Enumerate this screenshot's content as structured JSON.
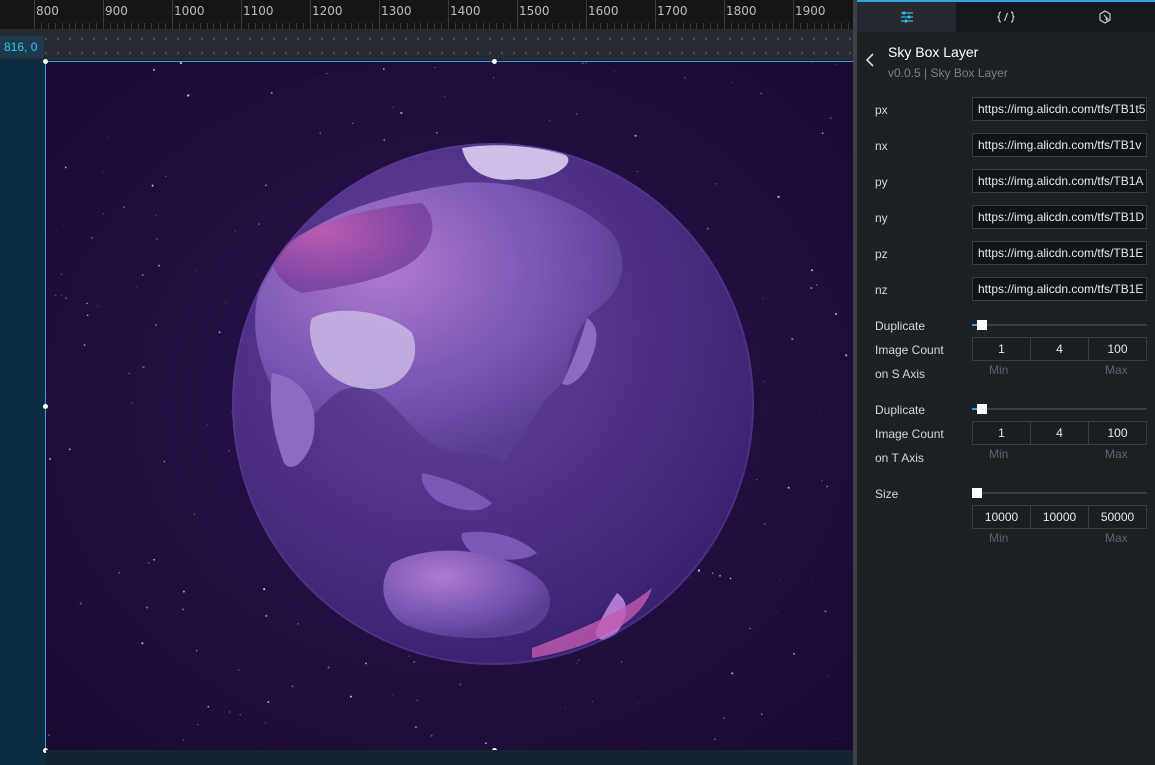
{
  "ruler": {
    "ticks": [
      "800",
      "900",
      "1000",
      "1100",
      "1200",
      "1300",
      "1400",
      "1500",
      "1600",
      "1700",
      "1800",
      "1900"
    ]
  },
  "canvas": {
    "coordinate_readout": "816, 0"
  },
  "panel": {
    "tabs": [
      {
        "name": "settings",
        "icon": "sliders-icon",
        "active": true
      },
      {
        "name": "code",
        "icon": "code-braces-icon",
        "active": false
      },
      {
        "name": "interaction",
        "icon": "interaction-icon",
        "active": false
      }
    ],
    "title": "Sky Box Layer",
    "subtitle": "v0.0.5 | Sky Box Layer",
    "images": [
      {
        "label": "px",
        "value": "https://img.alicdn.com/tfs/TB1t5"
      },
      {
        "label": "nx",
        "value": "https://img.alicdn.com/tfs/TB1v"
      },
      {
        "label": "py",
        "value": "https://img.alicdn.com/tfs/TB1A"
      },
      {
        "label": "ny",
        "value": "https://img.alicdn.com/tfs/TB1D"
      },
      {
        "label": "pz",
        "value": "https://img.alicdn.com/tfs/TB1E"
      },
      {
        "label": "nz",
        "value": "https://img.alicdn.com/tfs/TB1E"
      }
    ],
    "dup_s": {
      "label_lines": [
        "Duplicate",
        "Image Count",
        "on S Axis"
      ],
      "min": "1",
      "value": "4",
      "max": "100",
      "min_label": "Min",
      "max_label": "Max",
      "level": 0.03
    },
    "dup_t": {
      "label_lines": [
        "Duplicate",
        "Image Count",
        "on T Axis"
      ],
      "min": "1",
      "value": "4",
      "max": "100",
      "min_label": "Min",
      "max_label": "Max",
      "level": 0.03
    },
    "size": {
      "label": "Size",
      "min": "10000",
      "value": "10000",
      "max": "50000",
      "min_label": "Min",
      "max_label": "Max",
      "level": 0.0
    }
  },
  "colors": {
    "accent": "#2ea3e3",
    "panel_bg": "#1d2126",
    "scene_bg": "#1e0e3c",
    "globe": "#4d2f85"
  }
}
